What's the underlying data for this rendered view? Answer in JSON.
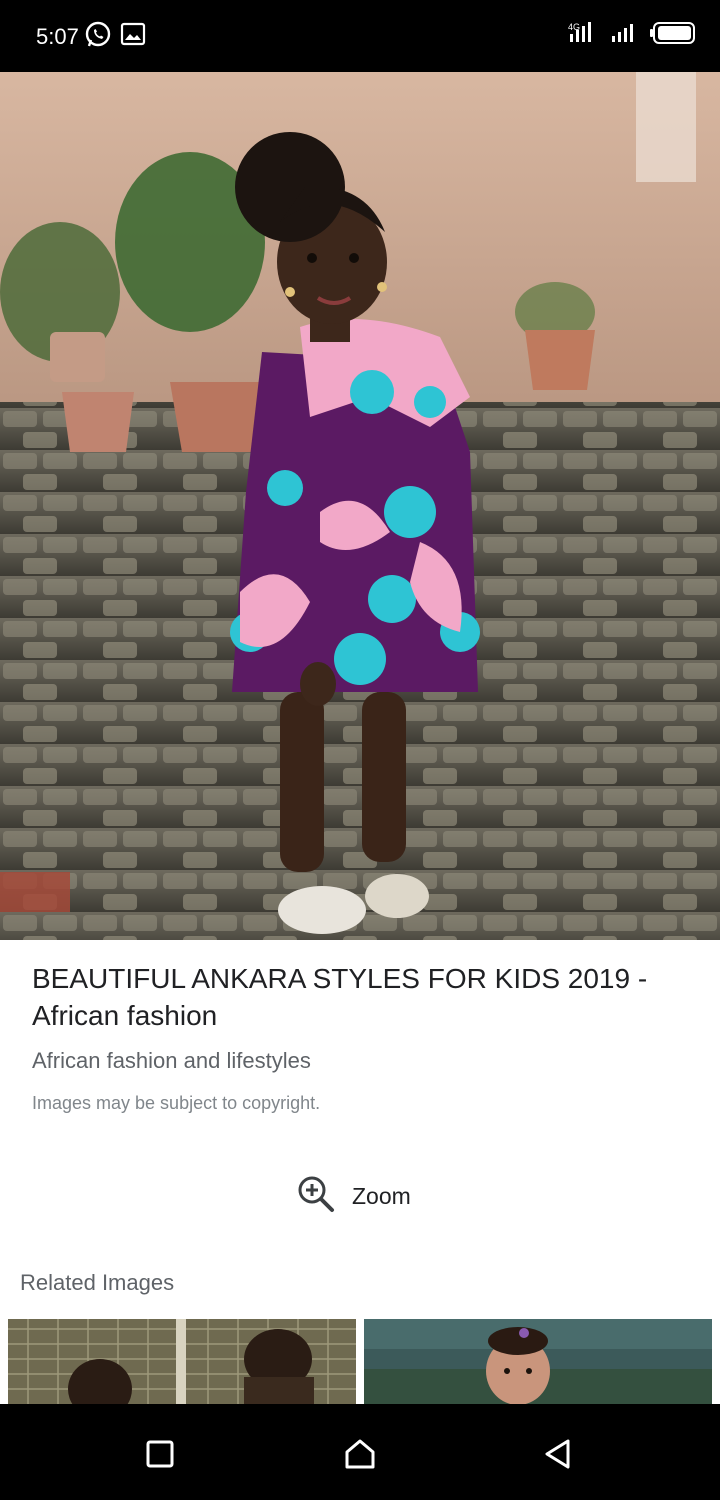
{
  "status_bar": {
    "time": "5:07",
    "left_icons": [
      "whatsapp-icon",
      "image-icon"
    ],
    "right_icons": [
      "signal-4g-icon",
      "signal-bars-icon",
      "battery-icon"
    ]
  },
  "hero_image": {
    "description_icon": "photo-girl-ankara-dress",
    "dress_colors": {
      "purple": "#5b1a63",
      "pink": "#f2a8c8",
      "teal": "#2ec4d4"
    }
  },
  "result": {
    "title": "BEAUTIFUL ANKARA STYLES FOR KIDS 2019 - African fashion",
    "source": "African fashion and lifestyles",
    "copyright": "Images may be subject to copyright."
  },
  "zoom": {
    "label": "Zoom",
    "icon": "zoom-in-icon"
  },
  "related": {
    "heading": "Related Images"
  },
  "nav_bar": {
    "icons": [
      "recents-icon",
      "home-icon",
      "back-icon"
    ]
  }
}
